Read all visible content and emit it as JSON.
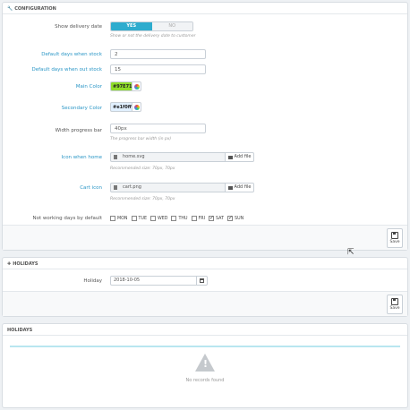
{
  "config": {
    "title": "CONFIGURATION",
    "show_delivery": {
      "label": "Show delivery date",
      "yes": "YES",
      "no": "NO",
      "help": "Show or not the delivery date to customer"
    },
    "days_in_stock": {
      "label": "Default days when stock",
      "value": "2"
    },
    "days_out_stock": {
      "label": "Default days when out stock",
      "value": "15"
    },
    "main_color": {
      "label": "Main Color",
      "value": "#97E71",
      "color": "#8fdc2a"
    },
    "secondary_color": {
      "label": "Secondary Color",
      "value": "#e1f0ff",
      "color": "#e1f0ff"
    },
    "width_progress": {
      "label": "Width progress bar",
      "value": "40px",
      "help": "The progress bar width (in px)"
    },
    "icon_home": {
      "label": "Icon when home",
      "file": "home.svg",
      "button": "Add file",
      "help": "Recommended size: 70px, 70px"
    },
    "cart_icon": {
      "label": "Cart icon",
      "file": "cart.png",
      "button": "Add file",
      "help": "Recommended size: 70px, 70px"
    },
    "not_working": {
      "label": "Not working days by default",
      "days": [
        {
          "name": "MON",
          "checked": false
        },
        {
          "name": "TUE",
          "checked": false
        },
        {
          "name": "WED",
          "checked": false
        },
        {
          "name": "THU",
          "checked": false
        },
        {
          "name": "FRI",
          "checked": false
        },
        {
          "name": "SAT",
          "checked": true
        },
        {
          "name": "SUN",
          "checked": true
        }
      ]
    },
    "save": "Save"
  },
  "holidays_form": {
    "title": "HOLIDAYS",
    "holiday": {
      "label": "Holiday",
      "value": "2018-10-05"
    },
    "save": "Save"
  },
  "holidays_list": {
    "title": "HOLIDAYS",
    "empty": "No records found"
  },
  "colors": {
    "accent": "#2eacce",
    "required_label": "#2a96c6"
  }
}
